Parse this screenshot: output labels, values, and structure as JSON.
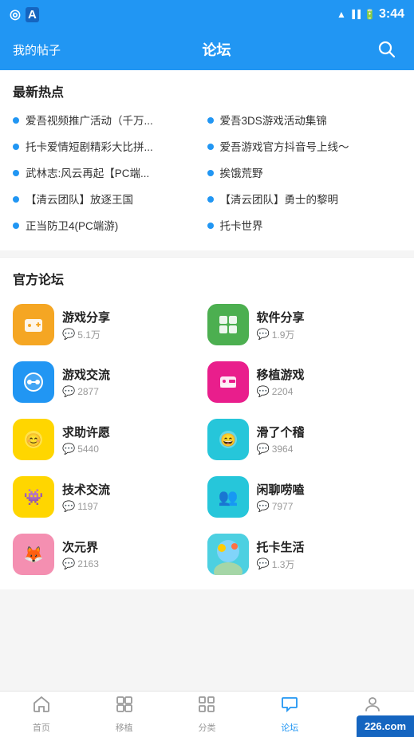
{
  "statusBar": {
    "time": "3:44",
    "leftIcons": [
      "◎",
      "A"
    ]
  },
  "header": {
    "leftLabel": "我的帖子",
    "title": "论坛",
    "searchLabel": "搜索"
  },
  "hotSection": {
    "title": "最新热点",
    "items": [
      "爱吾视频推广活动（千万...",
      "爱吾3DS游戏活动集锦",
      "托卡爱情短剧精彩大比拼...",
      "爱吾游戏官方抖音号上线～",
      "武林志:风云再起【PC端...",
      "挨饿荒野",
      "【清云团队】放逐王国",
      "【清云团队】勇士的黎明",
      "正当防卫4(PC端游)",
      "托卡世界"
    ]
  },
  "forumSection": {
    "title": "官方论坛",
    "items": [
      {
        "name": "游戏分享",
        "count": "5.1万",
        "color": "#F5A623",
        "icon": "🕹️"
      },
      {
        "name": "软件分享",
        "count": "1.9万",
        "color": "#4CAF50",
        "icon": "⊞"
      },
      {
        "name": "游戏交流",
        "count": "2877",
        "color": "#2196F3",
        "icon": "🎮"
      },
      {
        "name": "移植游戏",
        "count": "2204",
        "color": "#E91E8C",
        "icon": "🎮"
      },
      {
        "name": "求助许愿",
        "count": "5440",
        "color": "#FFEB3B",
        "icon": "😊"
      },
      {
        "name": "滑了个稽",
        "count": "3964",
        "color": "#26C6DA",
        "icon": "😄"
      },
      {
        "name": "技术交流",
        "count": "1197",
        "color": "#FFEB3B",
        "icon": "👾"
      },
      {
        "name": "闲聊唠嗑",
        "count": "7977",
        "color": "#26C6DA",
        "icon": "👥"
      },
      {
        "name": "次元界",
        "count": "2163",
        "color": "#F48FB1",
        "icon": "🦊"
      },
      {
        "name": "托卡生活",
        "count": "1.3万",
        "color": "#4DD0E1",
        "icon": "🌍"
      }
    ]
  },
  "bottomNav": {
    "items": [
      {
        "id": "home",
        "label": "首页",
        "icon": "⌂",
        "active": false
      },
      {
        "id": "migrate",
        "label": "移植",
        "icon": "⊡",
        "active": false
      },
      {
        "id": "category",
        "label": "分类",
        "icon": "▦",
        "active": false
      },
      {
        "id": "forum",
        "label": "论坛",
        "icon": "💬",
        "active": true
      },
      {
        "id": "mine",
        "label": "我的",
        "icon": "👤",
        "active": false
      }
    ]
  },
  "watermark": {
    "text": "226",
    "suffix": ".com"
  }
}
